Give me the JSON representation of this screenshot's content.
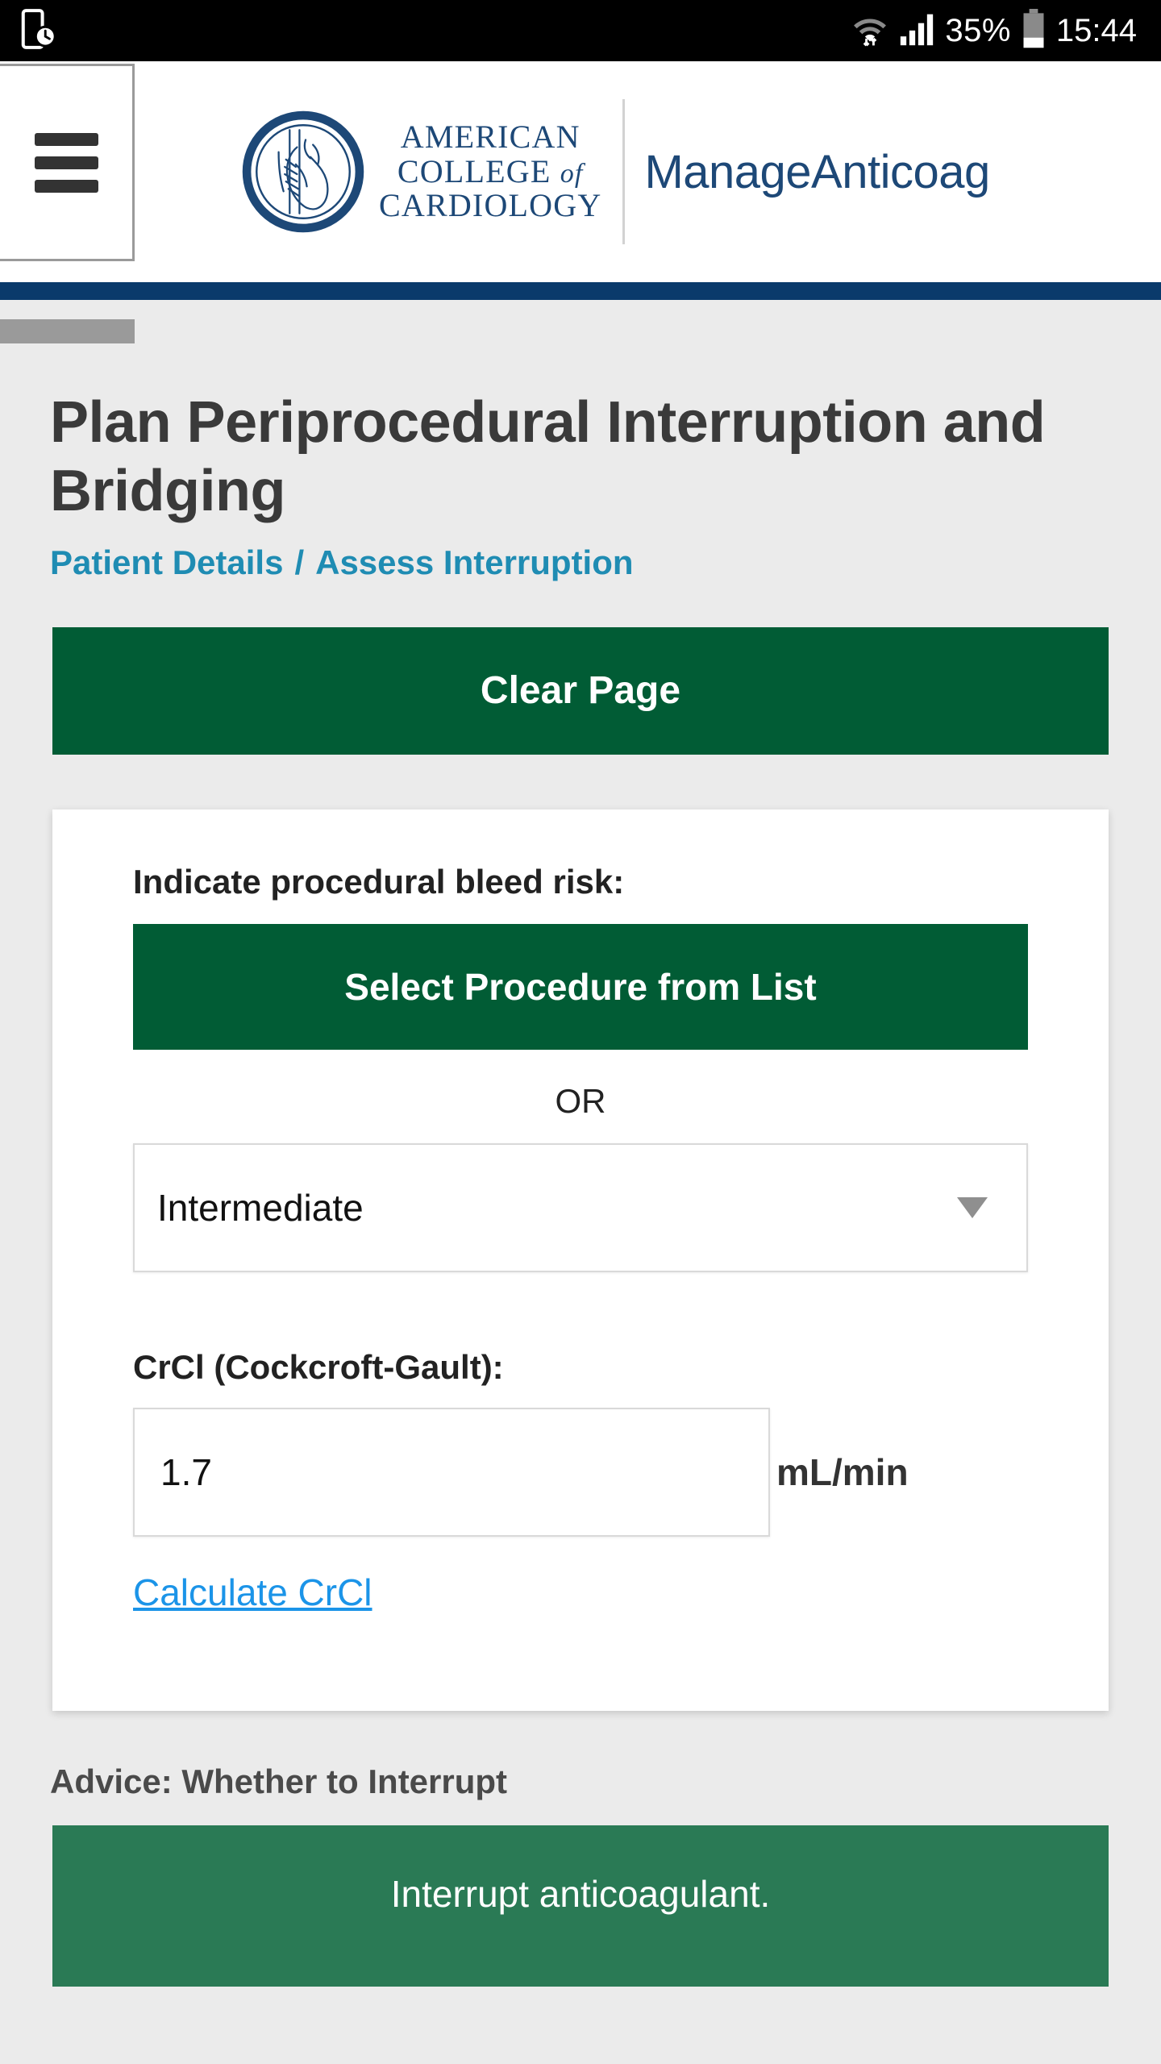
{
  "statusbar": {
    "left_icon": "device-clock-icon",
    "wifi_icon": "wifi-icon",
    "signal_icon": "signal-bars-icon",
    "battery_percent": "35%",
    "battery_icon": "battery-icon",
    "time": "15:44"
  },
  "header": {
    "menu_icon": "hamburger-menu-icon",
    "logo_icon": "acc-heart-seal-icon",
    "logo_line1": "AMERICAN",
    "logo_line2a": "COLLEGE ",
    "logo_line2b": "of",
    "logo_line3": "CARDIOLOGY",
    "app_title": "ManageAnticoag"
  },
  "page": {
    "title": "Plan Periprocedural Interruption and Bridging",
    "breadcrumb_first": "Patient Details",
    "breadcrumb_sep": "/",
    "breadcrumb_second": "Assess Interruption",
    "clear_button": "Clear Page"
  },
  "bleed_risk": {
    "label": "Indicate procedural bleed risk:",
    "select_procedure_button": "Select Procedure from List",
    "or_text": "OR",
    "risk_selected": "Intermediate",
    "caret_icon": "chevron-down-icon"
  },
  "crcl": {
    "label": "CrCl (Cockcroft-Gault):",
    "value": "1.7",
    "placeholder": "",
    "unit": "mL/min",
    "calculate_link": "Calculate CrCl"
  },
  "advice": {
    "heading": "Advice: Whether to Interrupt",
    "text": "Interrupt anticoagulant."
  },
  "colors": {
    "status_bar_bg": "#000000",
    "navy_bar": "#0a3a6b",
    "brand_navy": "#1d4877",
    "primary_green": "#015c35",
    "advice_green": "#2a7a55",
    "breadcrumb_teal": "#1f8cb3",
    "link_blue": "#1b94e8",
    "page_bg": "#ebebeb"
  }
}
